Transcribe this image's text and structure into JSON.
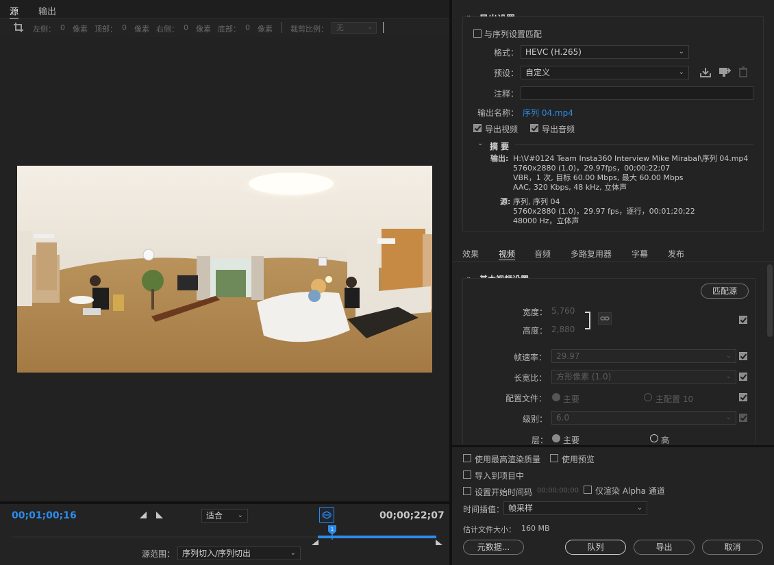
{
  "source_panel": {
    "tabs": [
      "源",
      "输出"
    ],
    "crop": {
      "left_label": "左侧：",
      "left_value": "0",
      "left_unit": "像素",
      "top_label": "顶部：",
      "top_value": "0",
      "top_unit": "像素",
      "right_label": "右侧：",
      "right_value": "0",
      "right_unit": "像素",
      "bottom_label": "底部：",
      "bottom_value": "0",
      "bottom_unit": "像素",
      "ratio_label": "裁剪比例：",
      "ratio_value": "无"
    },
    "current_time": "00;01;00;16",
    "fit_value": "适合",
    "duration": "00;00;22;07",
    "source_range_label": "源范围：",
    "source_range_value": "序列切入/序列切出"
  },
  "export_settings": {
    "section_title": "导出设置",
    "match_sequence_label": "与序列设置匹配",
    "match_sequence_checked": false,
    "format_label": "格式：",
    "format_value": "HEVC (H.265)",
    "preset_label": "预设：",
    "preset_value": "自定义",
    "comment_label": "注释：",
    "comment_value": "",
    "output_name_label": "输出名称：",
    "output_name_value": "序列 04.mp4",
    "export_video_label": "导出视频",
    "export_video_checked": true,
    "export_audio_label": "导出音频",
    "export_audio_checked": true,
    "summary_title": "摘 要",
    "summary_output_label": "输出:",
    "summary_output_lines": [
      "H:\\V#0124 Team Insta360 Interview Mike Mirabal\\序列 04.mp4",
      "5760x2880  (1.0)，29.97fps，00;00;22;07",
      "VBR，1 次, 目标  60.00  Mbps, 最大  60.00  Mbps",
      "AAC, 320 Kbps, 48  kHz, 立体声"
    ],
    "summary_source_label": "源:",
    "summary_source_lines": [
      "序列, 序列  04",
      "5760x2880  (1.0)，29.97 fps，逐行，00;01;20;22",
      "48000 Hz，立体声"
    ]
  },
  "settings_tabs": [
    "效果",
    "视频",
    "音频",
    "多路复用器",
    "字幕",
    "发布"
  ],
  "settings_tabs_active": "视频",
  "basic_video": {
    "section_title": "基本视频设置",
    "match_source_button": "匹配源",
    "width_label": "宽度：",
    "width_value": "5,760",
    "height_label": "高度：",
    "height_value": "2,880",
    "framerate_label": "帧速率：",
    "framerate_value": "29.97",
    "aspect_label": "长宽比：",
    "aspect_value": "方形像素 (1.0)",
    "profile_label": "配置文件：",
    "profile_main": "主要",
    "profile_main10": "主配置  10",
    "level_label": "级别：",
    "level_value": "6.0",
    "tier_label": "层：",
    "tier_main": "主要",
    "tier_high": "高"
  },
  "bottom_options": {
    "max_render_quality": "使用最高渲染质量",
    "use_previews": "使用预览",
    "import_into_project": "导入到项目中",
    "set_start_timecode": "设置开始时间码",
    "start_timecode_value": "00;00;00;00",
    "render_alpha_only": "仅渲染  Alpha 通道",
    "time_interpolation_label": "时间插值：",
    "time_interpolation_value": "帧采样",
    "estimated_size_label": "估计文件大小：",
    "estimated_size_value": "160 MB",
    "metadata_button": "元数据...",
    "queue_button": "队列",
    "export_button": "导出",
    "cancel_button": "取消"
  },
  "colors": {
    "accent_blue": "#2d8ceb",
    "bg": "#232323"
  }
}
